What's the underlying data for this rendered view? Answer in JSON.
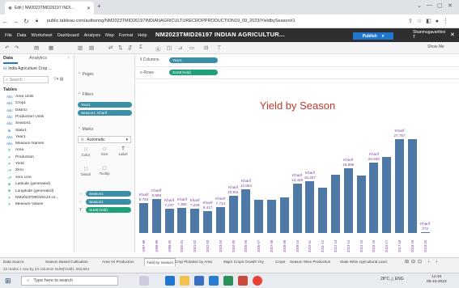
{
  "browser": {
    "tab_title": "Edit | NM2023TMID26197 INDI...",
    "url": "public.tableau.com/authoring/NM2023TMID26197INDIANAGRICULTURECROPPRODUCTION19_09_2023/YieldbySeason#1"
  },
  "tableau": {
    "menu": [
      "File",
      "Data",
      "Worksheet",
      "Dashboard",
      "Analysis",
      "Map",
      "Format",
      "Help"
    ],
    "workbook_title": "NM2023TMID26197 INDIAN AGRICULTUR...",
    "publish_label": "Publish",
    "user": "Shanmugavarthini T",
    "show_me": "Show Me"
  },
  "data_pane": {
    "tab_data": "Data",
    "tab_analytics": "Analytics",
    "datasource": "India Agriculture Crop ...",
    "search_placeholder": "Search",
    "tables_header": "Tables",
    "fields": [
      {
        "icon": "Abc",
        "name": "Area Units"
      },
      {
        "icon": "Abc",
        "name": "Crop1"
      },
      {
        "icon": "Abc",
        "name": "District"
      },
      {
        "icon": "Abc",
        "name": "Production Units"
      },
      {
        "icon": "Abc",
        "name": "Season1"
      },
      {
        "icon": "⊕",
        "name": "State1"
      },
      {
        "icon": "Abc",
        "name": "Year1"
      },
      {
        "icon": "Abc",
        "name": "Measure Names"
      },
      {
        "icon": "#",
        "name": "Area",
        "measure": true
      },
      {
        "icon": "#",
        "name": "Production",
        "measure": true
      },
      {
        "icon": "#",
        "name": "Yield",
        "measure": true
      },
      {
        "icon": "=#",
        "name": "Zero",
        "measure": true
      },
      {
        "icon": "=#",
        "name": "zero Line",
        "measure": true
      },
      {
        "icon": "⊕",
        "name": "Latitude (generated)",
        "measure": true
      },
      {
        "icon": "⊕",
        "name": "Longitude (generated)",
        "measure": true
      },
      {
        "icon": "#",
        "name": "NM2023TMID26123.cs...",
        "measure": true
      },
      {
        "icon": "#",
        "name": "Measure Values",
        "measure": true
      }
    ]
  },
  "shelves": {
    "pages": "Pages",
    "filters": "Filters",
    "filter_pills": [
      "Year1",
      "Season1: Kharif"
    ],
    "marks": "Marks",
    "mark_type": "Automatic",
    "mark_cards": [
      {
        "glyph": "⁙",
        "label": "Color"
      },
      {
        "glyph": "○",
        "label": "Size"
      },
      {
        "glyph": "T",
        "label": "Label"
      },
      {
        "glyph": "∷",
        "label": "Detail"
      },
      {
        "glyph": "□",
        "label": "Tooltip"
      }
    ],
    "mark_pills": [
      "Season1",
      "Season1",
      "SUM(Yield)"
    ],
    "columns_label": "Columns",
    "columns_pill": "Year1",
    "rows_label": "Rows",
    "rows_pill": "SUM(Yield)"
  },
  "chart_data": {
    "type": "bar",
    "title": "Yield by Season",
    "categories": [
      "1997-98",
      "1998-99",
      "1999-00",
      "2000-01",
      "2001-02",
      "2002-03",
      "2003-04",
      "2004-05",
      "2005-06",
      "2006-07",
      "2007-08",
      "2008-09",
      "2009-10",
      "2010-11",
      "2011-12",
      "2012-13",
      "2013-14",
      "2014-15",
      "2015-16",
      "2016-17",
      "2017-18",
      "2018-19",
      "2019-20"
    ],
    "values": [
      8764,
      9969,
      7237,
      7380,
      7228,
      6417,
      7714,
      10911,
      12853,
      9800,
      9750,
      10500,
      14449,
      15257,
      13400,
      17100,
      18995,
      16900,
      20630,
      22300,
      27767,
      27700,
      272
    ],
    "data_labels": [
      "8,764",
      "9,969",
      "7,237",
      "7,380",
      "7,228",
      "6,417",
      "7,714",
      "10,911",
      "12,853",
      "",
      "",
      "",
      "14,449",
      "15,257",
      "",
      "",
      "18,995",
      "",
      "20,630",
      "",
      "27,767",
      "",
      "272"
    ],
    "series_label": "Kharif",
    "ylim": [
      0,
      31000
    ]
  },
  "sheet_tabs": [
    "Data Source",
    "Season Based Cultivation",
    "Area Vs Production",
    "Yield by Season",
    "Crop Plotation by Area",
    "Major Crops Growth Yoy",
    "Crops",
    "Season Wise Production",
    "State Wise Agricultural Land"
  ],
  "active_tab": 3,
  "status": "23 marks    1 row by 23 columns    SUM(Yield): 303,834",
  "taskbar": {
    "search_placeholder": "Type here to search",
    "tray": "28°C  △ ENG",
    "time": "12:46",
    "date": "05-10-2023"
  }
}
